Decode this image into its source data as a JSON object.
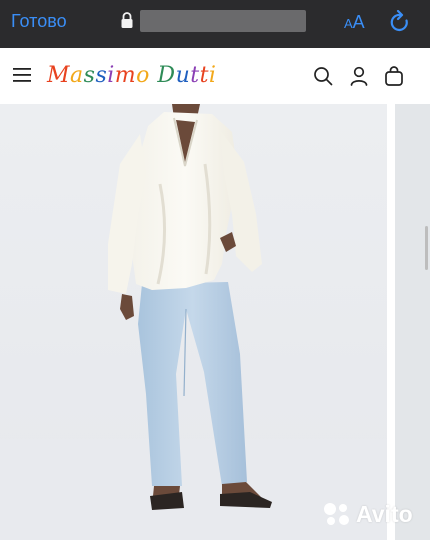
{
  "browser": {
    "done_label": "Готово",
    "text_size_small": "A",
    "text_size_large": "A"
  },
  "site": {
    "logo_text": "Massimo Dutti",
    "icons": [
      "menu-icon",
      "search-icon",
      "user-icon",
      "bag-icon"
    ]
  },
  "watermark": {
    "text": "Avito"
  },
  "colors": {
    "browser_bar": "#2b2b2d",
    "browser_accent": "#3a8ef6",
    "logo_colors": [
      "#e8421f",
      "#f2a81a",
      "#2e8b57",
      "#1e5fbf",
      "#8b3fb5"
    ]
  }
}
